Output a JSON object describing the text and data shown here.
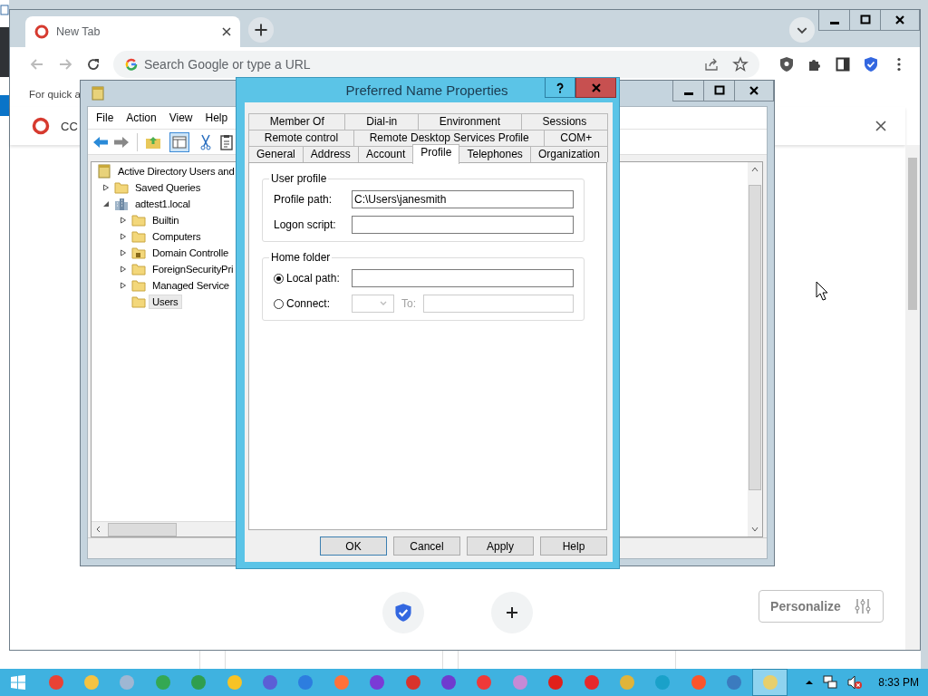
{
  "browser": {
    "tabs": [
      {
        "title": "New Tab",
        "selected": true
      }
    ],
    "address_bar": {
      "placeholder": "Search Google or type a URL"
    },
    "bookmarks_hint": "For quick a",
    "banner": {
      "text": "CC"
    },
    "personalize": "Personalize"
  },
  "aduc": {
    "menu": [
      "File",
      "Action",
      "View",
      "Help"
    ],
    "tree": [
      {
        "label": "Active Directory Users and",
        "kind": "root",
        "selected": false,
        "children": [
          {
            "label": "Saved Queries",
            "kind": "folder",
            "expanded": false,
            "selected": false
          },
          {
            "label": "adtest1.local",
            "kind": "domain",
            "expanded": true,
            "selected": false,
            "children": [
              {
                "label": "Builtin",
                "kind": "folder",
                "expanded": false,
                "selected": false
              },
              {
                "label": "Computers",
                "kind": "folder",
                "expanded": false,
                "selected": false
              },
              {
                "label": "Domain Controlle",
                "kind": "unit",
                "expanded": false,
                "selected": false
              },
              {
                "label": "ForeignSecurityPri",
                "kind": "folder",
                "expanded": false,
                "selected": false
              },
              {
                "label": "Managed Service",
                "kind": "folder",
                "expanded": false,
                "selected": false
              },
              {
                "label": "Users",
                "kind": "folder",
                "selected": true
              }
            ]
          }
        ]
      }
    ]
  },
  "dialog": {
    "title": "Preferred Name Properties",
    "tab_rows": [
      [
        {
          "label": "Member Of",
          "selected": false
        },
        {
          "label": "Dial-in",
          "selected": false
        },
        {
          "label": "Environment",
          "selected": false
        },
        {
          "label": "Sessions",
          "selected": false
        }
      ],
      [
        {
          "label": "Remote control",
          "selected": false
        },
        {
          "label": "Remote Desktop Services Profile",
          "selected": false
        },
        {
          "label": "COM+",
          "selected": false
        }
      ],
      [
        {
          "label": "General",
          "selected": false
        },
        {
          "label": "Address",
          "selected": false
        },
        {
          "label": "Account",
          "selected": false
        },
        {
          "label": "Profile",
          "selected": true
        },
        {
          "label": "Telephones",
          "selected": false
        },
        {
          "label": "Organization",
          "selected": false
        }
      ]
    ],
    "user_profile": {
      "title": "User profile",
      "fields": [
        {
          "label": "Profile path:",
          "value": "C:\\Users\\janesmith"
        },
        {
          "label": "Logon script:"
        }
      ]
    },
    "home_folder": {
      "title": "Home folder",
      "local_path": {
        "label": "Local path:",
        "selected": true
      },
      "connect": {
        "label": "Connect:",
        "selected": false,
        "drive_disabled": true,
        "to_label": "To:",
        "to_disabled": true
      }
    },
    "buttons": [
      {
        "label": "OK",
        "default": true
      },
      {
        "label": "Cancel",
        "default": false
      },
      {
        "label": "Apply",
        "default": false
      },
      {
        "label": "Help",
        "default": false
      }
    ]
  },
  "taskbar": {
    "apps": [
      {
        "color": "#e94235",
        "selected": false
      },
      {
        "color": "#f5c342",
        "selected": false
      },
      {
        "color": "#9fb7d3",
        "selected": false
      },
      {
        "color": "#34a853",
        "selected": false
      },
      {
        "color": "#2f9e4f",
        "selected": false
      },
      {
        "color": "#f7c325",
        "selected": false
      },
      {
        "color": "#5b5fd6",
        "selected": false
      },
      {
        "color": "#2d7ddf",
        "selected": false
      },
      {
        "color": "#ff7139",
        "selected": false
      },
      {
        "color": "#7a3bd6",
        "selected": false
      },
      {
        "color": "#d9332c",
        "selected": false
      },
      {
        "color": "#6f3bcf",
        "selected": false
      },
      {
        "color": "#ef3939",
        "selected": false
      },
      {
        "color": "#c58ad6",
        "selected": false
      },
      {
        "color": "#e0201b",
        "selected": false
      },
      {
        "color": "#e8282b",
        "selected": false
      },
      {
        "color": "#e0b43a",
        "selected": false
      },
      {
        "color": "#1aa1c9",
        "selected": false
      },
      {
        "color": "#fb542b",
        "selected": false
      },
      {
        "color": "#3b7bbf",
        "selected": false
      },
      {
        "color": "#e7cf6c",
        "selected": true
      }
    ],
    "clock": "8:33 PM"
  }
}
